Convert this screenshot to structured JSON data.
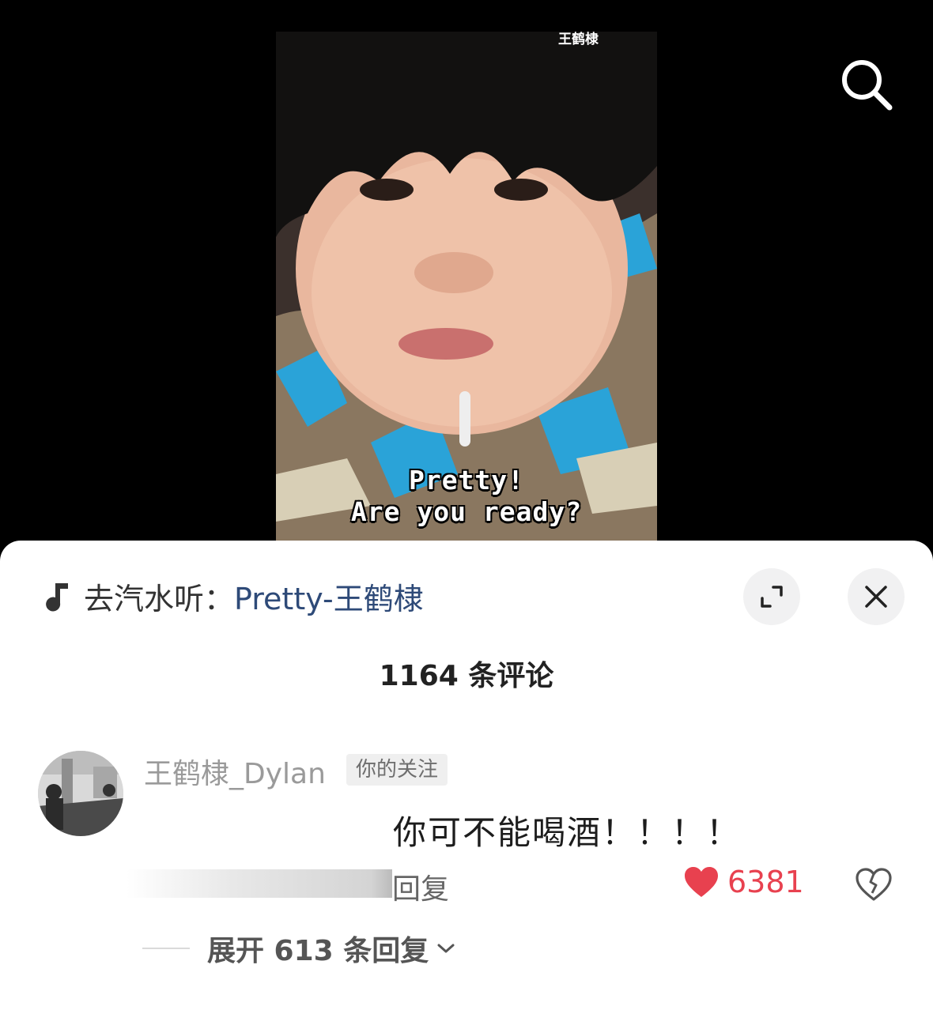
{
  "video": {
    "watermark": "王鹤棣",
    "subtitle_line1": "Pretty!",
    "subtitle_line2": "Are you ready?"
  },
  "header": {
    "music_prefix": "去汽水听：",
    "music_title": "Pretty-王鹤棣"
  },
  "comments_header": {
    "count_label": "1164 条评论"
  },
  "comment": {
    "username": "王鹤棣_Dylan",
    "badge": "你的关注",
    "text": "你可不能喝酒！！！！",
    "reply_label": "回复",
    "like_count": "6381",
    "expand_label": "展开 613 条回复"
  },
  "colors": {
    "like": "#e8414f",
    "link": "#2e4a78"
  }
}
